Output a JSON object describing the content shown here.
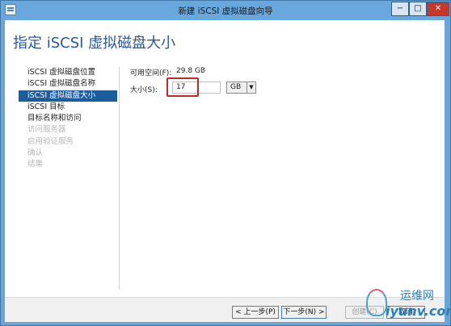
{
  "window": {
    "title": "新建 iSCSI 虚拟磁盘向导",
    "minimize_symbol": "−",
    "maximize_symbol": "□",
    "close_symbol": "✕"
  },
  "page_title": "指定 iSCSI 虚拟磁盘大小",
  "nav": {
    "items": [
      {
        "label": "iSCSI 虚拟磁盘位置",
        "state": "normal"
      },
      {
        "label": "iSCSI 虚拟磁盘名称",
        "state": "normal"
      },
      {
        "label": "iSCSI 虚拟磁盘大小",
        "state": "selected"
      },
      {
        "label": "iSCSI 目标",
        "state": "normal"
      },
      {
        "label": "目标名称和访问",
        "state": "normal"
      },
      {
        "label": "访问服务器",
        "state": "disabled"
      },
      {
        "label": "启用验证服务",
        "state": "disabled"
      },
      {
        "label": "确认",
        "state": "disabled"
      },
      {
        "label": "结果",
        "state": "disabled"
      }
    ]
  },
  "form": {
    "available_label": "可用空间(F):",
    "available_value": "29.8 GB",
    "size_label": "大小(S):",
    "size_value": "17",
    "unit_value": "GB",
    "unit_arrow": "▼"
  },
  "footer": {
    "prev_label": "< 上一步(P)",
    "next_label": "下一步(N) >",
    "create_label": "创建(C)",
    "cancel_label": "取消"
  },
  "watermark": {
    "cn": "运维网",
    "en": "iyunv.com"
  },
  "colors": {
    "titlebar": "#69a8dc",
    "selected_nav": "#1c5da0",
    "page_title": "#2a579a",
    "highlight_box": "#c0282a"
  }
}
